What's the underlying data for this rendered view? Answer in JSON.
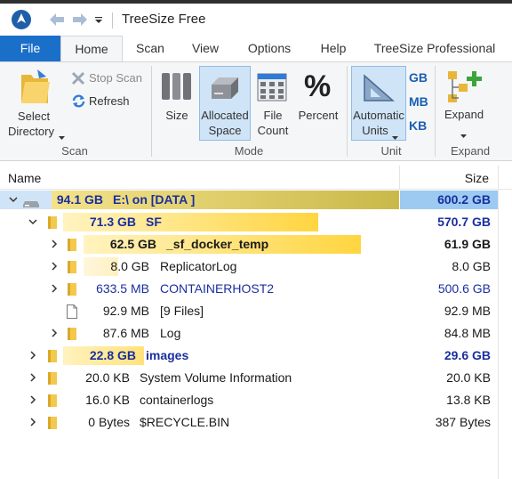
{
  "app": {
    "title": "TreeSize Free"
  },
  "tabs": [
    {
      "label": "File"
    },
    {
      "label": "Home"
    },
    {
      "label": "Scan"
    },
    {
      "label": "View"
    },
    {
      "label": "Options"
    },
    {
      "label": "Help"
    },
    {
      "label": "TreeSize Professional"
    }
  ],
  "ribbon": {
    "scan_group": {
      "select_directory_line1": "Select",
      "select_directory_line2": "Directory",
      "stop_scan": "Stop Scan",
      "refresh": "Refresh",
      "label": "Scan"
    },
    "mode_group": {
      "size": "Size",
      "allocated_line1": "Allocated",
      "allocated_line2": "Space",
      "file_count_line1": "File",
      "file_count_line2": "Count",
      "percent": "Percent",
      "label": "Mode"
    },
    "unit_group": {
      "automatic_line1": "Automatic",
      "automatic_line2": "Units",
      "gb": "GB",
      "mb": "MB",
      "kb": "KB",
      "label": "Unit"
    },
    "expand_group": {
      "expand": "Expand",
      "label": "Expand"
    }
  },
  "tree": {
    "columns": {
      "name": "Name",
      "size": "Size"
    },
    "rows": [
      {
        "size_left": "94.1 GB",
        "name": "E:\\  on  [DATA ]",
        "size_right": "600.2 GB",
        "bar_fraction": 1.0
      },
      {
        "size_left": "71.3 GB",
        "name": "SF",
        "size_right": "570.7 GB",
        "bar_fraction": 0.76
      },
      {
        "size_left": "62.5 GB",
        "name": "_sf_docker_temp",
        "size_right": "61.9 GB",
        "bar_fraction": 0.88
      },
      {
        "size_left": "8.0 GB",
        "name": "ReplicatorLog",
        "size_right": "8.0 GB",
        "bar_fraction": 0.11
      },
      {
        "size_left": "633.5 MB",
        "name": "CONTAINERHOST2",
        "size_right": "500.6 GB",
        "bar_fraction": 0.01
      },
      {
        "size_left": "92.9 MB",
        "name": "[9 Files]",
        "size_right": "92.9 MB",
        "bar_fraction": 0.0
      },
      {
        "size_left": "87.6 MB",
        "name": "Log",
        "size_right": "84.8 MB",
        "bar_fraction": 0.0
      },
      {
        "size_left": "22.8 GB",
        "name": "images",
        "size_right": "29.6 GB",
        "bar_fraction": 0.24
      },
      {
        "size_left": "20.0 KB",
        "name": "System Volume Information",
        "size_right": "20.0 KB",
        "bar_fraction": 0.0
      },
      {
        "size_left": "16.0 KB",
        "name": "containerlogs",
        "size_right": "13.8 KB",
        "bar_fraction": 0.0
      },
      {
        "size_left": "0 Bytes",
        "name": "$RECYCLE.BIN",
        "size_right": "387 Bytes",
        "bar_fraction": 0.0
      }
    ]
  },
  "colors": {
    "file_tab": "#1a6fc9",
    "root_bar": "#d4c65a",
    "folder_bar": "#ffd540",
    "highlight_blue": "#cfe4f7",
    "text_blue": "#1a2f9e"
  }
}
